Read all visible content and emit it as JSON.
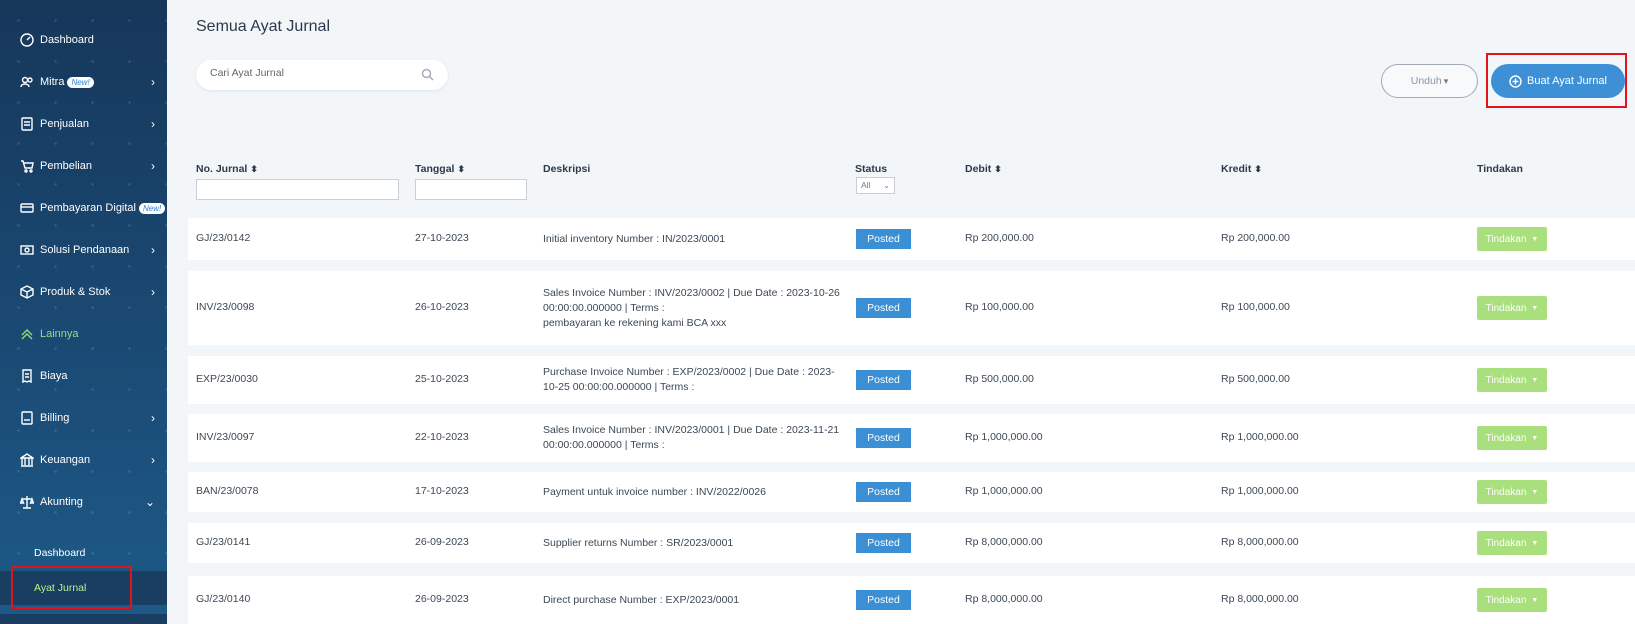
{
  "sidebar": {
    "items": [
      {
        "label": "Dashboard",
        "icon": "speedometer-icon",
        "has_chevron": false
      },
      {
        "label": "Mitra",
        "icon": "users-icon",
        "badge": "New!",
        "has_chevron": true
      },
      {
        "label": "Penjualan",
        "icon": "document-icon",
        "has_chevron": true
      },
      {
        "label": "Pembelian",
        "icon": "cart-icon",
        "has_chevron": true
      },
      {
        "label": "Pembayaran Digital",
        "icon": "card-icon",
        "badge": "New!",
        "has_chevron": true
      },
      {
        "label": "Solusi Pendanaan",
        "icon": "money-icon",
        "has_chevron": true
      },
      {
        "label": "Produk & Stok",
        "icon": "box-icon",
        "has_chevron": true
      },
      {
        "label": "Lainnya",
        "icon": "double-chevron-up-icon",
        "has_chevron": false
      },
      {
        "label": "Biaya",
        "icon": "receipt-icon",
        "has_chevron": false
      },
      {
        "label": "Billing",
        "icon": "bill-icon",
        "has_chevron": true
      },
      {
        "label": "Keuangan",
        "icon": "bank-icon",
        "has_chevron": true
      },
      {
        "label": "Akunting",
        "icon": "scale-icon",
        "has_chevron": true
      }
    ],
    "subitems": [
      {
        "label": "Dashboard"
      },
      {
        "label": "Ayat Jurnal"
      }
    ]
  },
  "main": {
    "title": "Semua Ayat Jurnal",
    "search_placeholder": "Cari Ayat Jurnal",
    "unduh_label": "Unduh",
    "buat_label": "Buat Ayat Jurnal"
  },
  "table": {
    "headers": {
      "no_jurnal": "No. Jurnal",
      "tanggal": "Tanggal",
      "deskripsi": "Deskripsi",
      "status": "Status",
      "debit": "Debit",
      "kredit": "Kredit",
      "tindakan": "Tindakan"
    },
    "status_filter": "All",
    "rows": [
      {
        "no": "GJ/23/0142",
        "tanggal": "27-10-2023",
        "deskripsi": [
          "Initial inventory Number : IN/2023/0001"
        ],
        "status": "Posted",
        "debit": "Rp 200,000.00",
        "kredit": "Rp 200,000.00",
        "action": "Tindakan"
      },
      {
        "no": "INV/23/0098",
        "tanggal": "26-10-2023",
        "deskripsi": [
          "Sales Invoice Number : INV/2023/0002 | Due Date : 2023-10-26",
          "00:00:00.000000 | Terms :",
          "pembayaran ke rekening kami BCA xxx"
        ],
        "status": "Posted",
        "debit": "Rp 100,000.00",
        "kredit": "Rp 100,000.00",
        "action": "Tindakan"
      },
      {
        "no": "EXP/23/0030",
        "tanggal": "25-10-2023",
        "deskripsi": [
          "Purchase Invoice Number : EXP/2023/0002 | Due Date : 2023-",
          "10-25 00:00:00.000000 | Terms :"
        ],
        "status": "Posted",
        "debit": "Rp 500,000.00",
        "kredit": "Rp 500,000.00",
        "action": "Tindakan"
      },
      {
        "no": "INV/23/0097",
        "tanggal": "22-10-2023",
        "deskripsi": [
          "Sales Invoice Number : INV/2023/0001 | Due Date : 2023-11-21",
          "00:00:00.000000 | Terms :"
        ],
        "status": "Posted",
        "debit": "Rp 1,000,000.00",
        "kredit": "Rp 1,000,000.00",
        "action": "Tindakan"
      },
      {
        "no": "BAN/23/0078",
        "tanggal": "17-10-2023",
        "deskripsi": [
          "Payment untuk invoice number : INV/2022/0026"
        ],
        "status": "Posted",
        "debit": "Rp 1,000,000.00",
        "kredit": "Rp 1,000,000.00",
        "action": "Tindakan"
      },
      {
        "no": "GJ/23/0141",
        "tanggal": "26-09-2023",
        "deskripsi": [
          "Supplier returns Number : SR/2023/0001"
        ],
        "status": "Posted",
        "debit": "Rp 8,000,000.00",
        "kredit": "Rp 8,000,000.00",
        "action": "Tindakan"
      },
      {
        "no": "GJ/23/0140",
        "tanggal": "26-09-2023",
        "deskripsi": [
          "Direct purchase Number : EXP/2023/0001"
        ],
        "status": "Posted",
        "debit": "Rp 8,000,000.00",
        "kredit": "Rp 8,000,000.00",
        "action": "Tindakan"
      }
    ]
  },
  "colors": {
    "primary": "#3d90d6",
    "posted": "#3b8fd4",
    "tindakan": "#a9df7d",
    "active_nav": "#8fe07a",
    "highlight_box": "#e3131b"
  }
}
